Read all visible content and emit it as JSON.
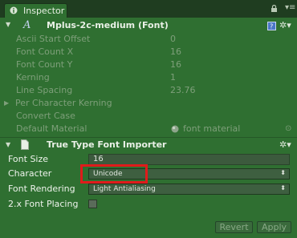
{
  "tab": {
    "label": "Inspector",
    "icon": "info-icon"
  },
  "toolbar": {
    "lock_icon": "lock-icon",
    "menu_icon": "tab-menu-icon"
  },
  "font_section": {
    "title": "Mplus-2c-medium (Font)",
    "icon": "font-asset-icon",
    "rows": [
      {
        "label": "Ascii Start Offset",
        "value": "0"
      },
      {
        "label": "Font Count X",
        "value": "16"
      },
      {
        "label": "Font Count Y",
        "value": "16"
      },
      {
        "label": "Kerning",
        "value": "1"
      },
      {
        "label": "Line Spacing",
        "value": "23.76"
      },
      {
        "label": "Per Character Kerning",
        "value": ""
      },
      {
        "label": "Convert Case",
        "value": ""
      },
      {
        "label": "Default Material",
        "value": "font material"
      }
    ]
  },
  "importer_section": {
    "title": "True Type Font Importer",
    "font_size_label": "Font Size",
    "font_size_value": "16",
    "character_label": "Character",
    "character_value": "Unicode",
    "rendering_label": "Font Rendering",
    "rendering_value": "Light Antialiasing",
    "placing_label": "2.x Font Placing",
    "placing_checked": false
  },
  "buttons": {
    "revert": "Revert",
    "apply": "Apply"
  },
  "colors": {
    "panel": "#2f6f31",
    "highlight": "#e01b1b"
  }
}
